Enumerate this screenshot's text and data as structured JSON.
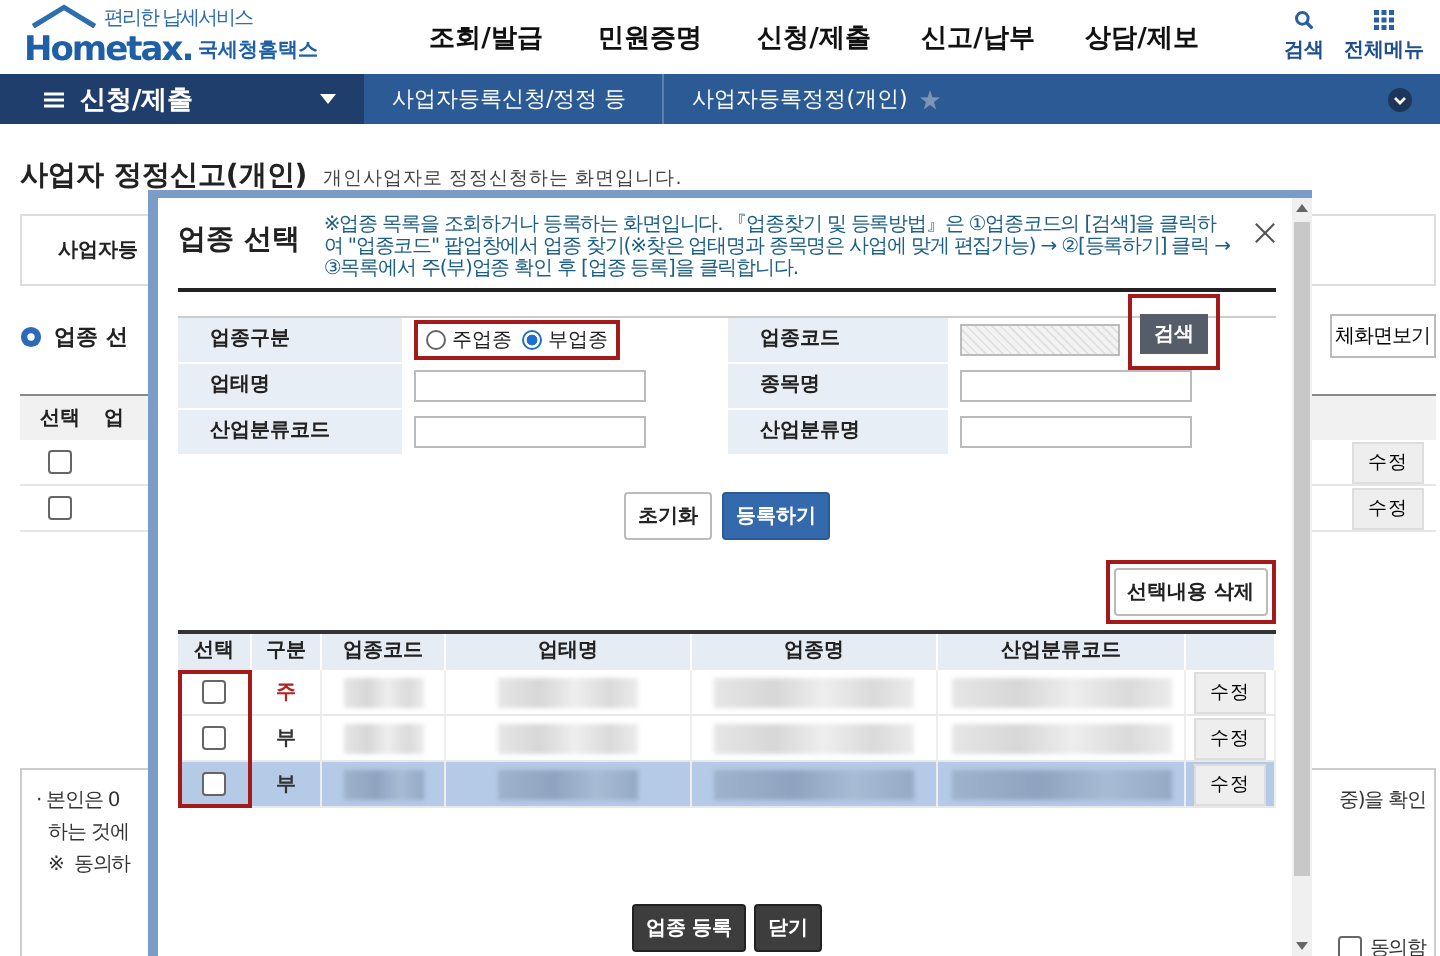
{
  "header": {
    "tagline": "편리한 납세서비스",
    "logo": "Hometax.",
    "logo_sub": "국세청홈택스",
    "menu": [
      "조회/발급",
      "민원증명",
      "신청/제출",
      "신고/납부",
      "상담/제보"
    ],
    "tools": [
      {
        "label": "검색",
        "kind": "search"
      },
      {
        "label": "전체메뉴",
        "kind": "grid"
      }
    ]
  },
  "nav": {
    "menu_button": "신청/제출",
    "crumbs": [
      "사업자등록신청/정정 등",
      "사업자등록정정(개인)"
    ],
    "favorite": false
  },
  "page": {
    "title": "사업자 정정신고(개인)",
    "subtitle": "개인사업자로 정정신청하는 화면입니다.",
    "tab_partial": "사업자등",
    "section_title": "업종 선",
    "fullscreen_button": "체화면보기",
    "table_header": [
      "선택",
      "업"
    ],
    "rows": [
      {
        "checked": false,
        "edit": "수정"
      },
      {
        "checked": false,
        "edit": "수정"
      }
    ],
    "notice_lines": [
      "· 본인은 0",
      "하는 것에",
      "※  동의하"
    ],
    "notice_right": "중)을 확인",
    "agree": {
      "label": "동의함",
      "checked": false
    }
  },
  "modal": {
    "title": "업종 선택",
    "notice": "※업종 목록을 조회하거나 등록하는 화면입니다. 『업종찾기 및 등록방법』은 ①업종코드의 [검색]을 클릭하여 \"업종코드\" 팝업창에서 업종 찾기(※찾은 업태명과 종목명은 사업에 맞게 편집가능) → ②[등록하기] 클릭 → ③목록에서 주(부)업종 확인 후 [업종 등록]을 클릭합니다.",
    "form": {
      "type_label": "업종구분",
      "type_highlighted": true,
      "type_options": [
        {
          "label": "주업종",
          "selected": false
        },
        {
          "label": "부업종",
          "selected": true
        }
      ],
      "code_label": "업종코드",
      "search_button": "검색",
      "search_highlighted": true,
      "fields": [
        {
          "label": "업태명"
        },
        {
          "label": "종목명"
        },
        {
          "label": "산업분류코드"
        },
        {
          "label": "산업분류명"
        }
      ]
    },
    "reset_button": "초기화",
    "register_button": "등록하기",
    "delete_button": "선택내용 삭제",
    "delete_highlighted": true,
    "grid": {
      "columns": [
        "선택",
        "구분",
        "업종코드",
        "업태명",
        "업종명",
        "산업분류코드"
      ],
      "check_column_highlighted": true,
      "rows": [
        {
          "checked": false,
          "type": "주",
          "kind": "primary",
          "selected": false,
          "edit": "수정"
        },
        {
          "checked": false,
          "type": "부",
          "kind": "secondary",
          "selected": false,
          "edit": "수정"
        },
        {
          "checked": false,
          "type": "부",
          "kind": "secondary",
          "selected": true,
          "edit": "수정"
        }
      ]
    },
    "footer_buttons": [
      "업종 등록",
      "닫기"
    ]
  }
}
